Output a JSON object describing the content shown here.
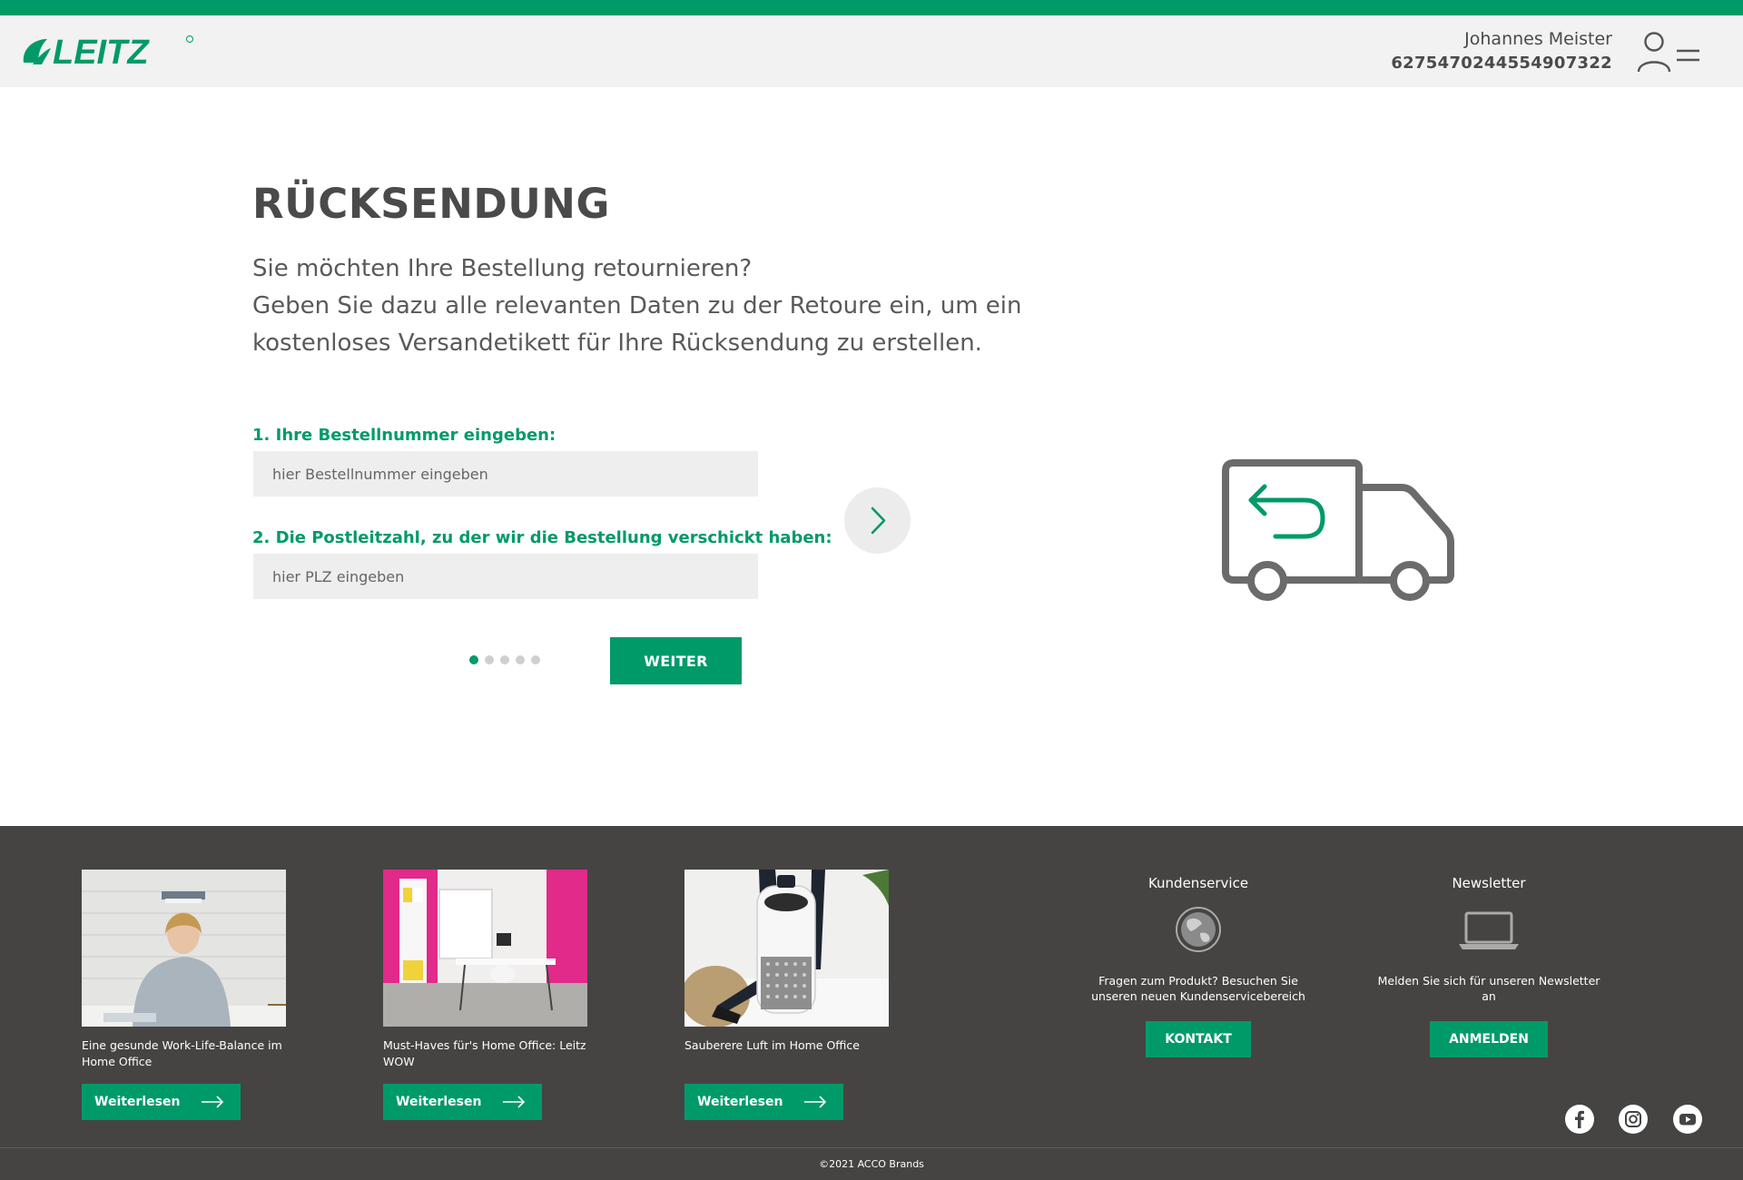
{
  "header": {
    "brand": "LEITZ",
    "user_name": "Johannes Meister",
    "user_id": "6275470244554907322"
  },
  "main": {
    "title": "RÜCKSENDUNG",
    "intro_lines": [
      "Sie möchten Ihre Bestellung retournieren?",
      "Geben Sie dazu alle relevanten Daten zu der Retoure ein, um ein",
      "kostenloses Versandetikett für Ihre Rücksendung zu erstellen."
    ],
    "step1_label": "1. Ihre Bestellnummer eingeben:",
    "step1_placeholder": "hier Bestellnummer eingeben",
    "step1_value": "",
    "step2_label": "2. Die Postleitzahl, zu der wir die Bestellung verschickt haben:",
    "step2_placeholder": "hier PLZ eingeben",
    "step2_value": "",
    "progress": {
      "current": 1,
      "total": 5
    },
    "next_button": "WEITER"
  },
  "footer": {
    "articles": [
      {
        "title": "Eine gesunde Work-Life-Balance im Home Office",
        "button": "Weiterlesen"
      },
      {
        "title": "Must-Haves für's Home Office: Leitz WOW",
        "button": "Weiterlesen"
      },
      {
        "title": "Sauberere Luft im Home Office",
        "button": "Weiterlesen"
      }
    ],
    "kundenservice": {
      "title": "Kundenservice",
      "text": "Fragen zum Produkt? Besuchen Sie unseren neuen Kundenservicebereich",
      "button": "KONTAKT"
    },
    "newsletter": {
      "title": "Newsletter",
      "text": "Melden Sie sich für unseren Newsletter an",
      "button": "ANMELDEN"
    },
    "social_icons": [
      "facebook-icon",
      "instagram-icon",
      "youtube-icon"
    ],
    "copyright": "©2021 ACCO Brands"
  },
  "colors": {
    "brand_green": "#009a69",
    "footer_bg": "#454443",
    "header_bg": "#f2f2f2"
  }
}
